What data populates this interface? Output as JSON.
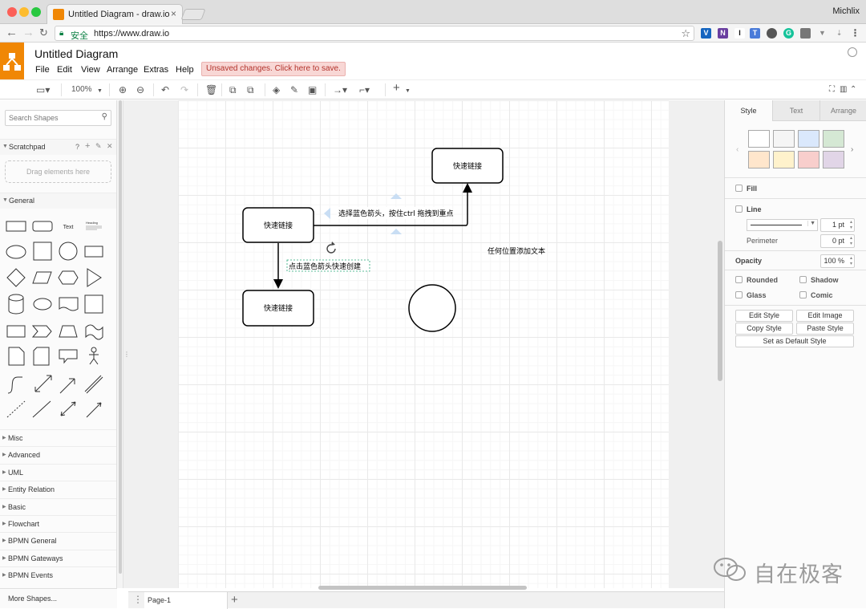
{
  "browser": {
    "tab_title": "Untitled Diagram - draw.io",
    "tab_close": "×",
    "profile": "Michlix",
    "secure_label": "安全",
    "url": "https://www.draw.io"
  },
  "app": {
    "title": "Untitled Diagram",
    "menus": [
      "File",
      "Edit",
      "View",
      "Arrange",
      "Extras",
      "Help"
    ],
    "unsaved": "Unsaved changes. Click here to save."
  },
  "toolbar": {
    "zoom": "100%"
  },
  "sidebar": {
    "search_placeholder": "Search Shapes",
    "scratchpad": "Scratchpad",
    "scratchpad_help": "?",
    "drag_hint": "Drag elements here",
    "general": "General",
    "text_shape": "Text",
    "heading_shape": "Heading",
    "sections": [
      "Misc",
      "Advanced",
      "UML",
      "Entity Relation",
      "Basic",
      "Flowchart",
      "BPMN General",
      "BPMN Gateways",
      "BPMN Events"
    ],
    "more_shapes": "More Shapes..."
  },
  "diagram": {
    "node_top_right": "快速链接",
    "node_left": "快速链接",
    "node_bottom": "快速链接",
    "edge_label_horizontal": "选择蓝色箭头，按住ctrl 拖拽到重点",
    "edge_label_vertical": "点击蓝色箭头快速创建",
    "free_text": "任何位置添加文本"
  },
  "pages": {
    "tab": "Page-1"
  },
  "format": {
    "tabs": [
      "Style",
      "Text",
      "Arrange"
    ],
    "swatches": [
      "#ffffff",
      "#f5f5f5",
      "#dae8fc",
      "#d5e8d4",
      "#ffe6cc",
      "#fff2cc",
      "#f8cecc",
      "#e1d5e7"
    ],
    "fill": "Fill",
    "line": "Line",
    "line_width": "1 pt",
    "perimeter": "Perimeter",
    "perimeter_value": "0 pt",
    "opacity": "Opacity",
    "opacity_value": "100 %",
    "rounded": "Rounded",
    "shadow": "Shadow",
    "glass": "Glass",
    "comic": "Comic",
    "edit_style": "Edit Style",
    "edit_image": "Edit Image",
    "copy_style": "Copy Style",
    "paste_style": "Paste Style",
    "set_default": "Set as Default Style"
  },
  "watermark": "自在极客",
  "colors": {
    "drawio_orange": "#f08705",
    "selection_blue": "#29b6f2",
    "unsaved_red": "#b3332c"
  }
}
